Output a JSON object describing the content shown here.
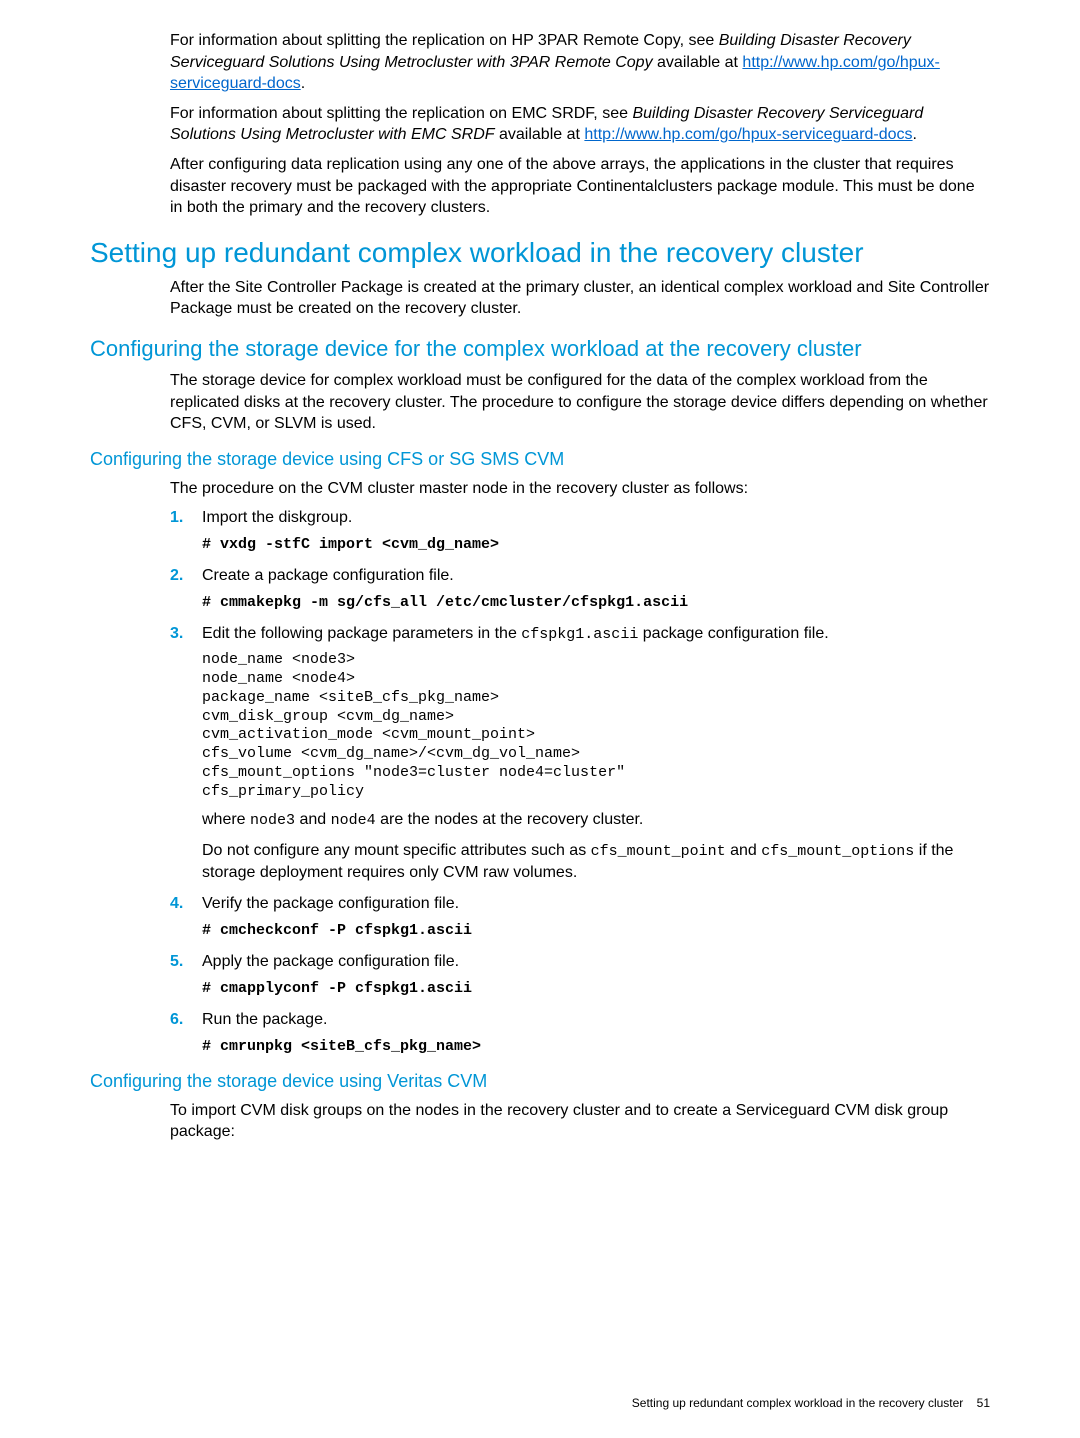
{
  "intro": {
    "p1_a": "For information about splitting the replication on HP 3PAR Remote Copy, see ",
    "p1_italic": " Building Disaster Recovery Serviceguard Solutions Using Metrocluster with 3PAR Remote Copy ",
    "p1_b": " available at ",
    "p1_link": "http://www.hp.com/go/hpux-serviceguard-docs",
    "p1_c": ".",
    "p2_a": "For information about splitting the replication on EMC SRDF, see ",
    "p2_italic": " Building Disaster Recovery Serviceguard Solutions Using Metrocluster with EMC SRDF",
    "p2_b": " available at ",
    "p2_link": " http://www.hp.com/go/hpux-serviceguard-docs",
    "p2_c": ".",
    "p3": "After configuring data replication using any one of the above arrays, the applications in the cluster that requires disaster recovery must be packaged with the appropriate Continentalclusters package module. This must be done in both the primary and the recovery clusters."
  },
  "h1": "Setting up redundant complex workload in the recovery cluster",
  "h1_para": "After the Site Controller Package is created at the primary cluster, an identical complex workload and Site Controller Package must be created on the recovery cluster.",
  "h2": "Configuring the storage device for the complex workload at the recovery cluster",
  "h2_para": "The storage device for complex workload must be configured for the data of the complex workload from the replicated disks at the recovery cluster. The procedure to configure the storage device differs depending on whether CFS, CVM, or SLVM is used.",
  "h3a": "Configuring the storage device using CFS or SG SMS CVM",
  "h3a_intro": "The procedure on the CVM cluster master node in the recovery cluster as follows:",
  "steps_a": {
    "s1_text": "Import the diskgroup.",
    "s1_code": "# vxdg -stfC import <cvm_dg_name>",
    "s2_text": "Create a package configuration file.",
    "s2_code": "# cmmakepkg -m sg/cfs_all /etc/cmcluster/cfspkg1.ascii",
    "s3_text_a": "Edit the following package parameters in the ",
    "s3_code_inline": "cfspkg1.ascii",
    "s3_text_b": " package configuration file.",
    "s3_block": "node_name <node3>\nnode_name <node4>\npackage_name <siteB_cfs_pkg_name>\ncvm_disk_group <cvm_dg_name>\ncvm_activation_mode <cvm_mount_point>\ncfs_volume <cvm_dg_name>/<cvm_dg_vol_name>\ncfs_mount_options \"node3=cluster node4=cluster\"\ncfs_primary_policy",
    "s3_where_a": "where ",
    "s3_where_code1": "node3",
    "s3_where_mid": " and ",
    "s3_where_code2": "node4",
    "s3_where_b": " are the nodes at the recovery cluster.",
    "s3_note_a": "Do not configure any mount specific attributes such as ",
    "s3_note_code1": "cfs_mount_point",
    "s3_note_mid": " and ",
    "s3_note_code2": "cfs_mount_options",
    "s3_note_b": " if the storage deployment requires only CVM raw volumes.",
    "s4_text": "Verify the package configuration file.",
    "s4_code": "# cmcheckconf -P cfspkg1.ascii",
    "s5_text": "Apply the package configuration file.",
    "s5_code": "# cmapplyconf -P cfspkg1.ascii",
    "s6_text": "Run the package.",
    "s6_code": "# cmrunpkg <siteB_cfs_pkg_name>"
  },
  "h3b": "Configuring the storage device using Veritas CVM",
  "h3b_para": "To import CVM disk groups on the nodes in the recovery cluster and to create a Serviceguard CVM disk group package:",
  "footer_text": "Setting up redundant complex workload in the recovery cluster",
  "footer_page": "51"
}
